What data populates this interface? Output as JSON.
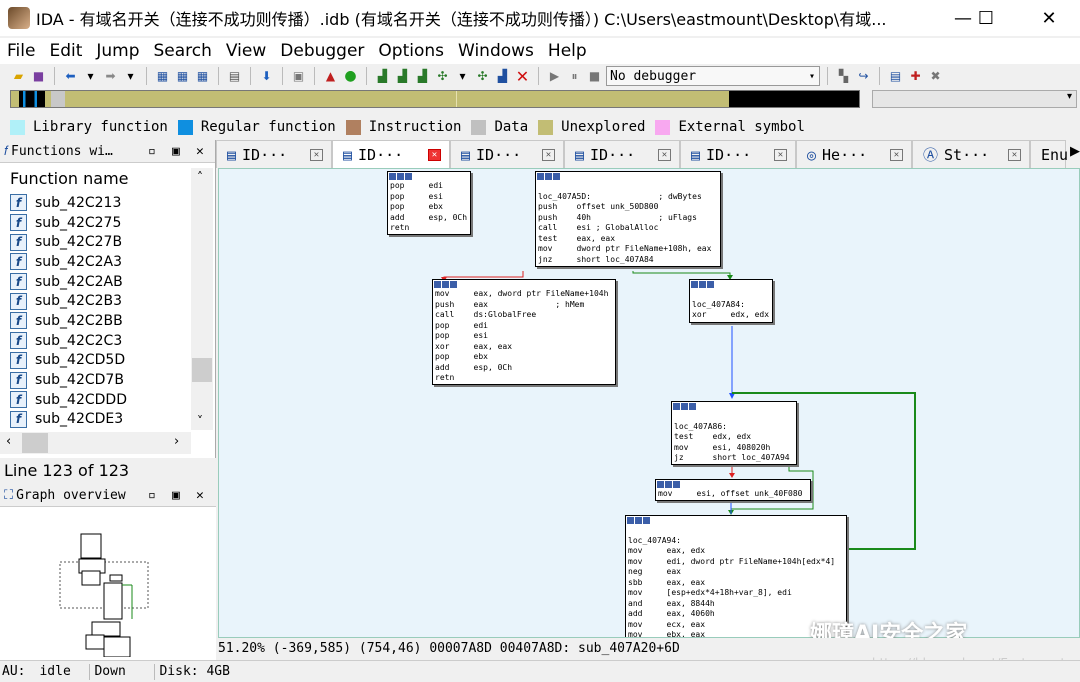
{
  "window": {
    "title": "IDA - 有域名开关（连接不成功则传播）.idb (有域名开关（连接不成功则传播）) C:\\Users\\eastmount\\Desktop\\有域...",
    "minimize": "—",
    "maximize": "☐",
    "close": "✕"
  },
  "menu": [
    "File",
    "Edit",
    "Jump",
    "Search",
    "View",
    "Debugger",
    "Options",
    "Windows",
    "Help"
  ],
  "toolbar": {
    "debugger": "No debugger"
  },
  "legend": [
    {
      "label": "Library function",
      "color": "#b0f0f8"
    },
    {
      "label": "Regular function",
      "color": "#0f8fe0"
    },
    {
      "label": "Instruction",
      "color": "#b08060"
    },
    {
      "label": "Data",
      "color": "#c0c0c0"
    },
    {
      "label": "Unexplored",
      "color": "#c2bd74"
    },
    {
      "label": "External symbol",
      "color": "#f8a8f0"
    }
  ],
  "functions_panel": {
    "title": "Functions wi…",
    "column": "Function name",
    "items": [
      "sub_42C213",
      "sub_42C275",
      "sub_42C27B",
      "sub_42C2A3",
      "sub_42C2AB",
      "sub_42C2B3",
      "sub_42C2BB",
      "sub_42C2C3",
      "sub_42CD5D",
      "sub_42CD7B",
      "sub_42CDDD",
      "sub_42CDE3"
    ]
  },
  "line_info": "Line 123 of 123",
  "overview_panel": {
    "title": "Graph overview"
  },
  "tabs": [
    "ID···",
    "ID···",
    "ID···",
    "ID···",
    "ID···",
    "He···",
    "St···",
    "Enu"
  ],
  "nodes": {
    "n1": "pop     edi\npop     esi\npop     ebx\nadd     esp, 0Ch\nretn",
    "n2": "\nloc_407A5D:              ; dwBytes\npush    offset unk_50D800\npush    40h              ; uFlags\ncall    esi ; GlobalAlloc\ntest    eax, eax\nmov     dword ptr FileName+108h, eax\njnz     short loc_407A84",
    "n3": "mov     eax, dword ptr FileName+104h\npush    eax              ; hMem\ncall    ds:GlobalFree\npop     edi\npop     esi\nxor     eax, eax\npop     ebx\nadd     esp, 0Ch\nretn",
    "n4": "\nloc_407A84:\nxor     edx, edx",
    "n5": "\nloc_407A86:\ntest    edx, edx\nmov     esi, 408020h\njz      short loc_407A94",
    "n6": "mov     esi, offset unk_40F080",
    "n7": "\nloc_407A94:\nmov     eax, edx\nmov     edi, dword ptr FileName+104h[edx*4]\nneg     eax\nsbb     eax, eax\nmov     [esp+edx*4+18h+var_8], edi\nand     eax, 8844h\nadd     eax, 4060h\nmov     ecx, eax\nmov     ebx, eax"
  },
  "status_line": "51.20% (-369,585) (754,46) 00007A8D 00407A8D: sub_407A20+6D",
  "bottom": {
    "au": "AU:",
    "state": "idle",
    "dir": "Down",
    "disk": "Disk: 4GB"
  },
  "watermark": "娜璋AI安全之家",
  "watermark2": "https://blog.csdn.net/Eastmount"
}
